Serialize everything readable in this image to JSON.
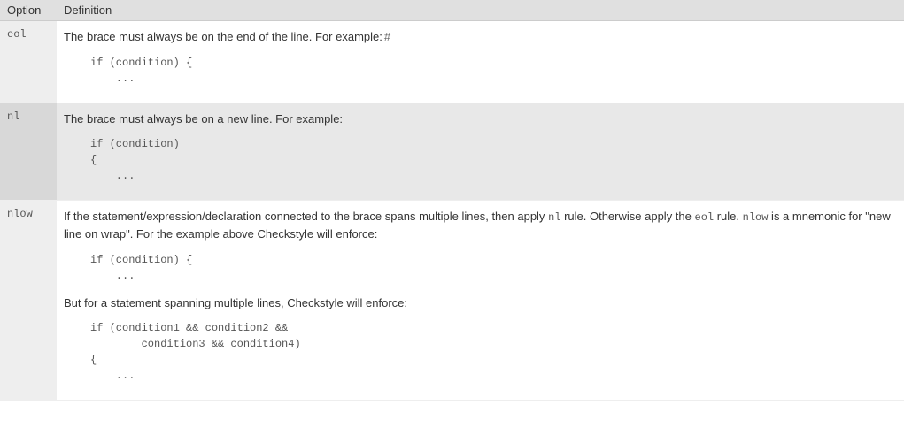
{
  "headers": {
    "option": "Option",
    "definition": "Definition"
  },
  "rows": {
    "eol": {
      "option": "eol",
      "desc": "The brace must always be on the end of the line. For example:",
      "hash": "#",
      "code": "if (condition) {\n    ..."
    },
    "nl": {
      "option": "nl",
      "desc": "The brace must always be on a new line. For example:",
      "code": "if (condition)\n{\n    ..."
    },
    "nlow": {
      "option": "nlow",
      "desc_part1": "If the statement/expression/declaration connected to the brace spans multiple lines, then apply ",
      "inline_nl": "nl",
      "desc_part2": " rule. Otherwise apply the ",
      "inline_eol": "eol",
      "desc_part3": " rule. ",
      "inline_nlow": "nlow",
      "desc_part4": " is a mnemonic for \"new line on wrap\". For the example above Checkstyle will enforce:",
      "code1": "if (condition) {\n    ...",
      "mid": "But for a statement spanning multiple lines, Checkstyle will enforce:",
      "code2": "if (condition1 && condition2 &&\n        condition3 && condition4)\n{\n    ..."
    }
  }
}
